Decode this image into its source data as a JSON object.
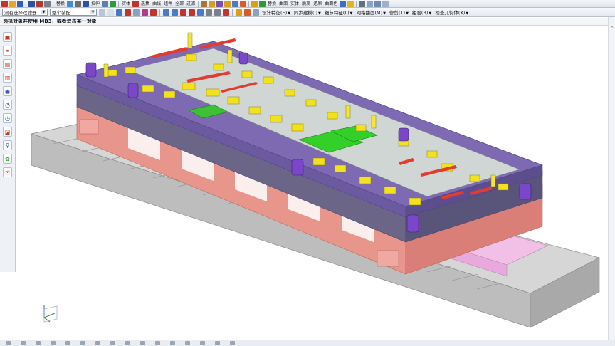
{
  "toolbar": {
    "quick_labels": [
      "替换",
      "拉伸",
      "实体",
      "选集",
      "曲线",
      "组件",
      "全部",
      "过滤",
      "替换",
      "曲面",
      "实体",
      "脱离",
      "还原",
      "曲面色"
    ],
    "accent_colors": [
      "#c2342c",
      "#2e62b6",
      "#2f9a3a",
      "#d8a016",
      "#7b4fb0"
    ]
  },
  "filter_bar": {
    "selection_filter": "没有选择过滤器",
    "scope": "整个装配",
    "menus": [
      {
        "label": "设计特征(E)"
      },
      {
        "label": "同步建模(I)"
      },
      {
        "label": "细节特征(L)"
      },
      {
        "label": "网格曲面(M)"
      },
      {
        "label": "修剪(T)"
      },
      {
        "label": "组合(B)"
      },
      {
        "label": "检查几何体(X)"
      }
    ]
  },
  "cue_line": {
    "text": "选择对象并使用 MB3，或者双击某一对象"
  },
  "resource_bar": {
    "icons": [
      "assembly-navigator-icon",
      "constraint-navigator-icon",
      "part-navigator-icon",
      "reuse-library-icon",
      "web-browser-icon",
      "history-icon",
      "system-materials-icon",
      "process-studio-icon",
      "roles-icon",
      "system-scene-icon",
      "manufacturing-wizard-icon"
    ]
  },
  "viewport": {
    "model": "progressive die assembly",
    "colors": {
      "purple_plate": "#7d6ab3",
      "slate_plate": "#6b6688",
      "salmon_block": "#e8958c",
      "pink_plate": "#f2bfe6",
      "grey_base": "#c9c9c9",
      "yellow_part": "#f2e21e",
      "green_part": "#34d02a",
      "red_part": "#e43b2e",
      "violet_post": "#7a47c8"
    }
  }
}
